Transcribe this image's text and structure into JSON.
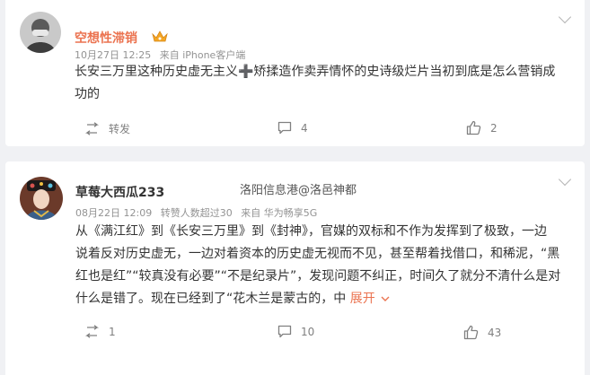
{
  "posts": [
    {
      "username": "空想性滞销",
      "username_color": "#eb7350",
      "time": "10月27日 12:25",
      "source": "来自 iPhone客户端",
      "content_lines": [
        "长安三万里这种历史虚无主义➕矫揉造作卖弄情怀的史诗级烂片当初到底是怎么营销成",
        "功的"
      ],
      "actions": {
        "repost": "转发",
        "comments": "4",
        "likes": "2"
      }
    },
    {
      "username": "草莓大西瓜233",
      "username_color": "#333333",
      "time": "08月22日 12:09",
      "repost_count": "转赞人数超过30",
      "source": "来自 华为畅享5G",
      "watermark": "洛阳信息港@洛邑神都",
      "content_lines": [
        "从《满江红》到《长安三万里》到《封神》，官媒的双标和不作为发挥到了极致，一边",
        "说着反对历史虚无，一边对着资本的历史虚无视而不见，甚至帮着找借口，和稀泥，“黑",
        "红也是红”“较真没有必要”“不是纪录片”，发现问题不纠正，时间久了就分不清什么是对",
        "什么是错了。现在已经到了“花木兰是蒙古的，中"
      ],
      "expand_label": "展开",
      "actions": {
        "repost": "1",
        "comments": "10",
        "likes": "43"
      }
    }
  ],
  "colors": {
    "accent": "#eb7350",
    "background": "#f0f1f4"
  }
}
